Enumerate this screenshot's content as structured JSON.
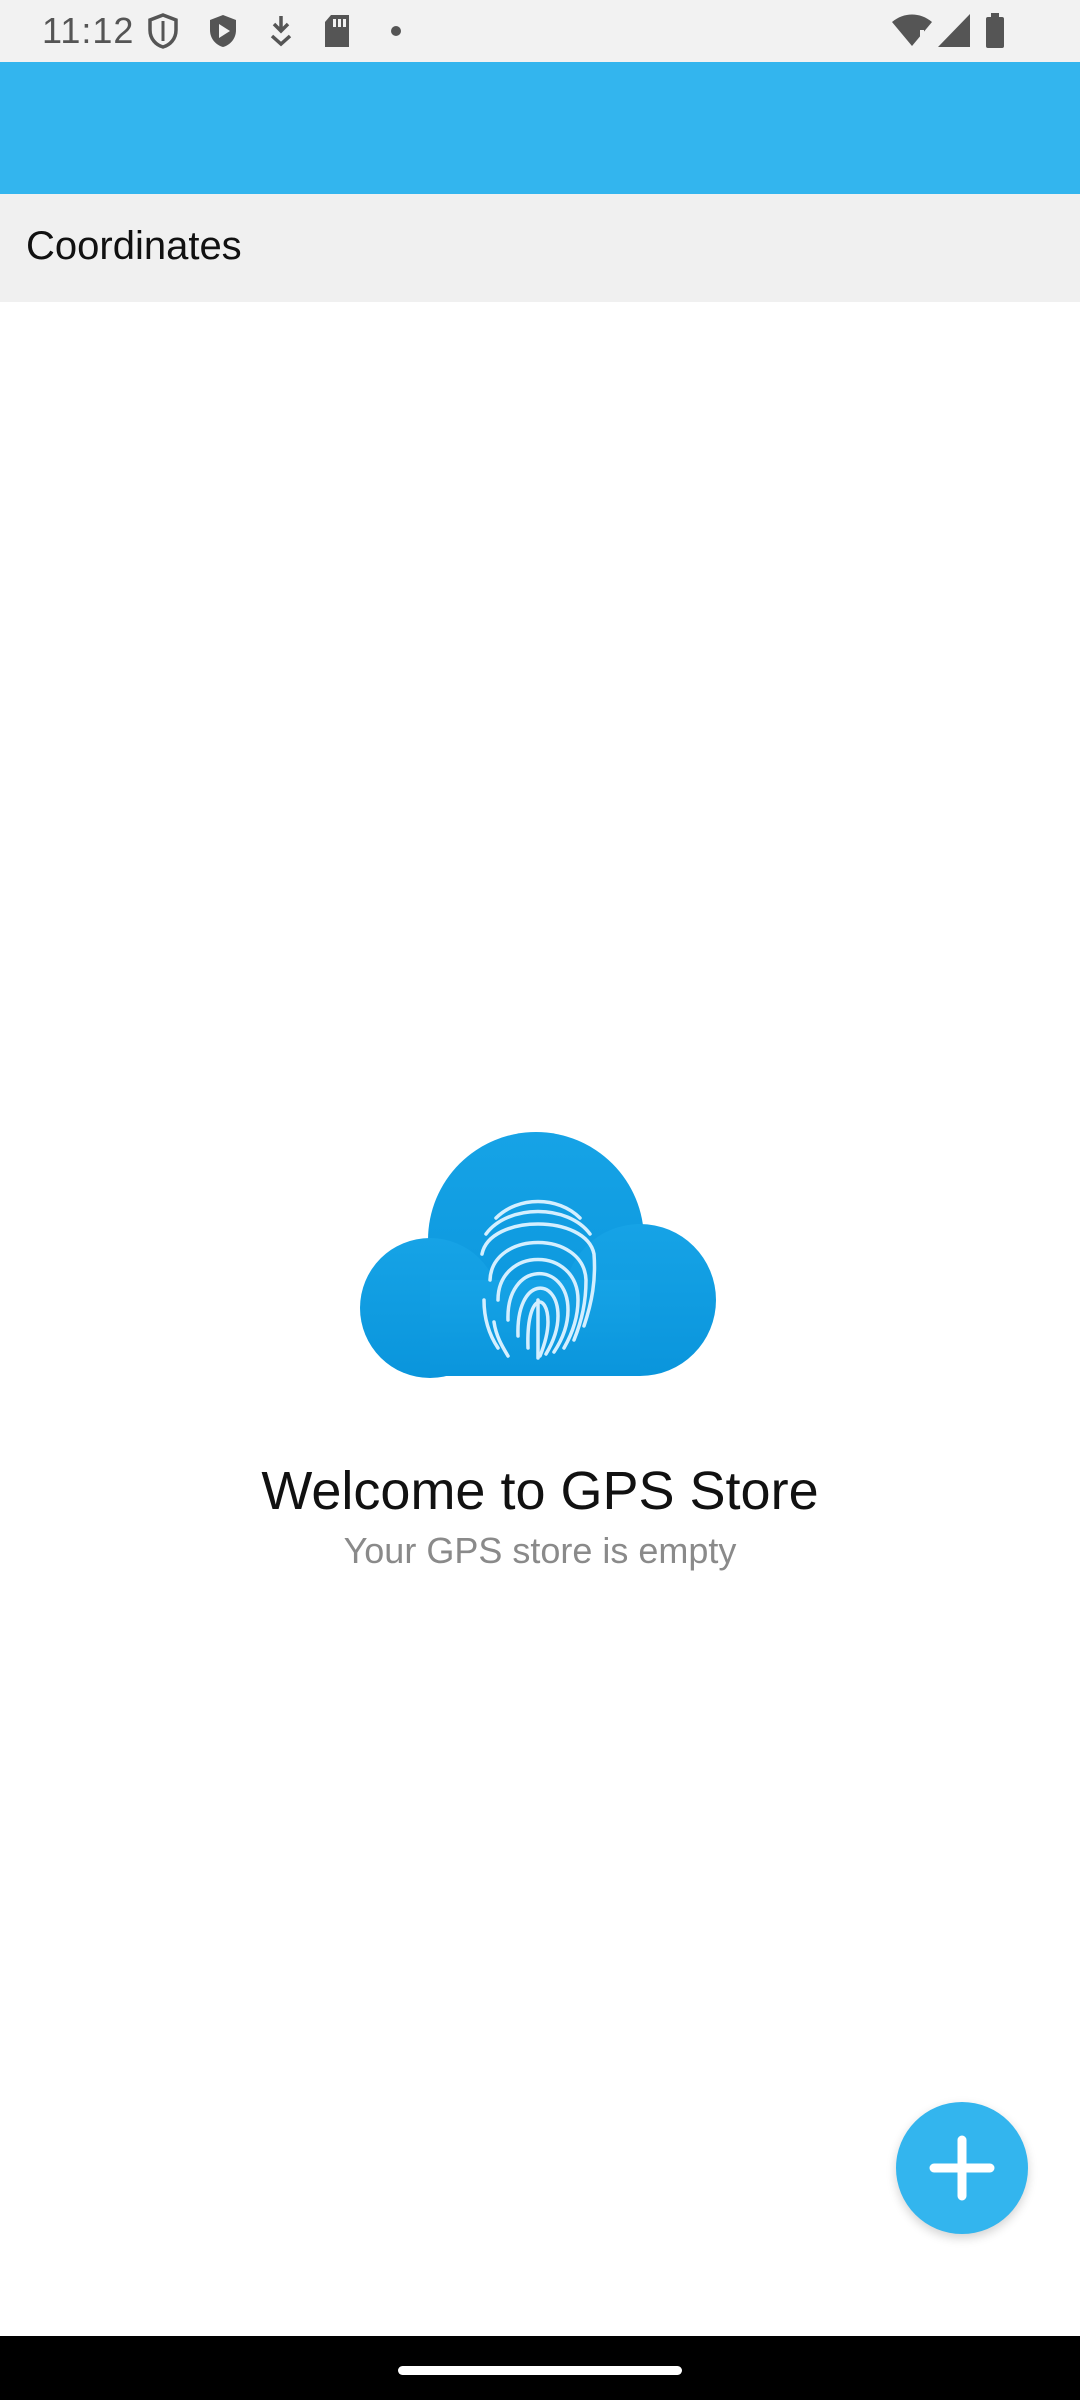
{
  "status_bar": {
    "time": "11:12",
    "left_icons": [
      "shield-outline-icon",
      "shield-play-icon",
      "download-badge-icon",
      "sd-card-icon",
      "dot-icon"
    ],
    "right_icons": [
      "wifi-alert-icon",
      "cellular-signal-icon",
      "battery-icon"
    ]
  },
  "app_bar": {
    "color": "#33b5ee"
  },
  "section": {
    "title": "Coordinates"
  },
  "empty_state": {
    "icon": "cloud-fingerprint-icon",
    "title": "Welcome to GPS Store",
    "subtitle": "Your GPS store is empty"
  },
  "fab": {
    "icon": "plus-icon",
    "color": "#33b5ee"
  },
  "nav_bar": {
    "indicator": "home-indicator"
  }
}
